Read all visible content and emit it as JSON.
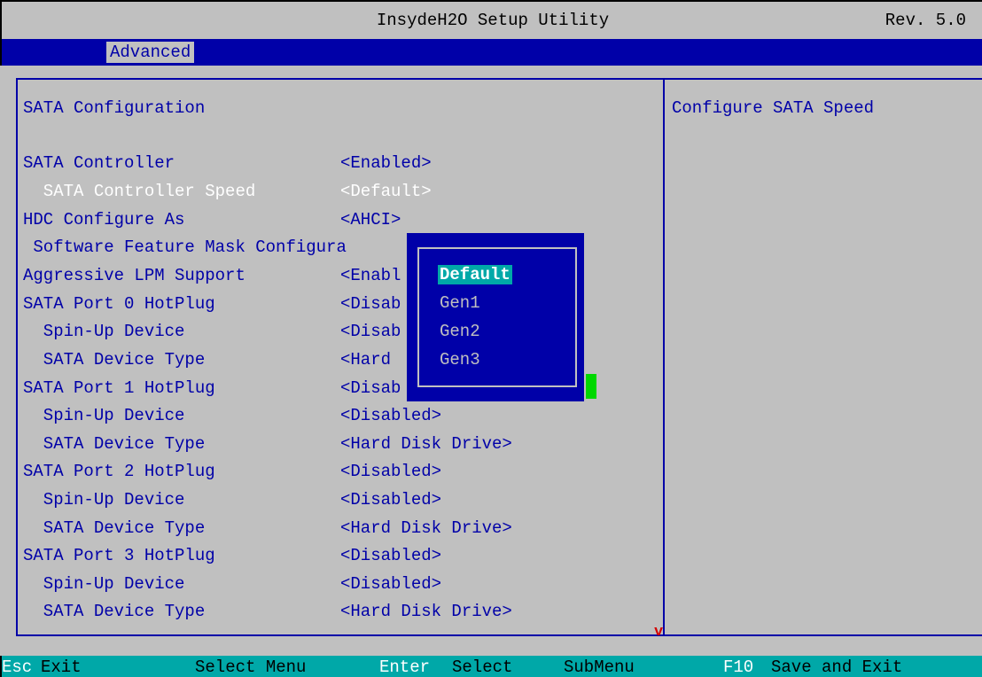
{
  "header": {
    "title": "InsydeH2O Setup Utility",
    "revision": "Rev. 5.0"
  },
  "menu": {
    "active_tab": "Advanced"
  },
  "page": {
    "title": "SATA Configuration"
  },
  "settings": [
    {
      "label": "SATA Controller",
      "value": "<Enabled>",
      "highlight": false
    },
    {
      "label": "  SATA Controller Speed",
      "value": "<Default>",
      "highlight": true
    },
    {
      "label": "HDC Configure As",
      "value": "<AHCI>",
      "highlight": false
    },
    {
      "label": " Software Feature Mask Configura",
      "value": "",
      "highlight": false
    },
    {
      "label": "Aggressive LPM Support",
      "value": "<Enabl",
      "highlight": false
    },
    {
      "label": "SATA Port 0 HotPlug",
      "value": "<Disab",
      "highlight": false
    },
    {
      "label": "  Spin-Up Device",
      "value": "<Disab",
      "highlight": false
    },
    {
      "label": "  SATA Device Type",
      "value": "<Hard",
      "highlight": false
    },
    {
      "label": "SATA Port 1 HotPlug",
      "value": "<Disab",
      "highlight": false
    },
    {
      "label": "  Spin-Up Device",
      "value": "<Disabled>",
      "highlight": false
    },
    {
      "label": "  SATA Device Type",
      "value": "<Hard Disk Drive>",
      "highlight": false
    },
    {
      "label": "SATA Port 2 HotPlug",
      "value": "<Disabled>",
      "highlight": false
    },
    {
      "label": "  Spin-Up Device",
      "value": "<Disabled>",
      "highlight": false
    },
    {
      "label": "  SATA Device Type",
      "value": "<Hard Disk Drive>",
      "highlight": false
    },
    {
      "label": "SATA Port 3 HotPlug",
      "value": "<Disabled>",
      "highlight": false
    },
    {
      "label": "  Spin-Up Device",
      "value": "<Disabled>",
      "highlight": false
    },
    {
      "label": "  SATA Device Type",
      "value": "<Hard Disk Drive>",
      "highlight": false
    }
  ],
  "help": {
    "text": "Configure SATA Speed"
  },
  "scroll_indicator": "v",
  "popup": {
    "options": [
      "Default",
      "Gen1",
      "Gen2",
      "Gen3"
    ],
    "selected": "Default"
  },
  "status_bar": [
    {
      "key": "Esc",
      "desc": "Exit"
    },
    {
      "key": "",
      "desc": "Select Menu"
    },
    {
      "key": "Enter",
      "desc": "Select"
    },
    {
      "key": "",
      "desc": "SubMenu"
    },
    {
      "key": "F10",
      "desc": "Save and Exit"
    }
  ],
  "colors": {
    "background": "#c0c0c0",
    "text": "#0000a8",
    "highlight_text": "#ffffff",
    "menubar": "#0000a8",
    "statusbar": "#00a8a8",
    "popup_selected": "#00a8a8",
    "scroll_arrow": "#d40000",
    "cursor": "#00d800"
  }
}
